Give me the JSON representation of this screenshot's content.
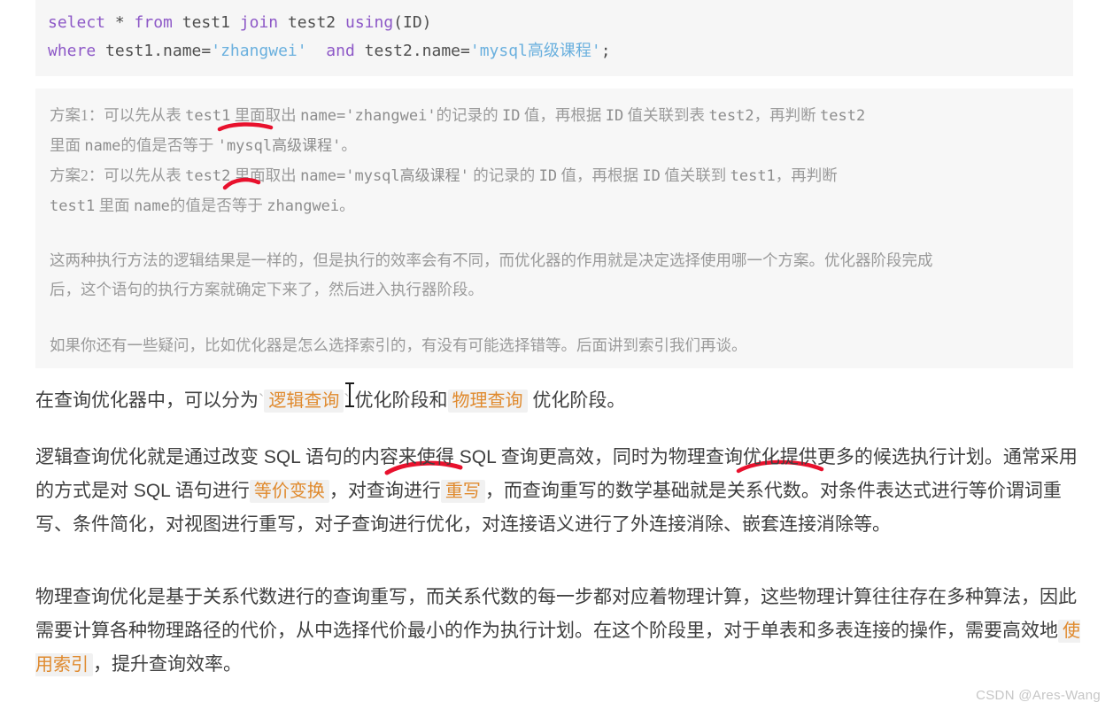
{
  "code_block": {
    "language": "sql",
    "line1": {
      "kw_select": "select",
      "star": " * ",
      "kw_from": "from",
      "t1": " test1 ",
      "kw_join": "join",
      "t2": " test2 ",
      "kw_using": "using",
      "using_args": "(ID)"
    },
    "line2": {
      "kw_where": "where",
      "col1": " test1.name=",
      "str1": "'zhangwei'",
      "kw_and": "  and ",
      "col2": "test2.name=",
      "str2": "'mysql高级课程'",
      "semi": ";"
    }
  },
  "quote": {
    "plan1_line1_a": "方案1：可以先从表 ",
    "plan1_line1_t": "test1",
    "plan1_line1_b": " 里面取出 ",
    "plan1_line1_c": "name='zhangwei'",
    "plan1_line1_d": "的记录的 ",
    "plan1_line1_e": "ID",
    "plan1_line1_f": " 值，再根据 ",
    "plan1_line1_g": "ID",
    "plan1_line1_h": " 值关联到表 ",
    "plan1_line1_i": "test2",
    "plan1_line1_j": "，再判断 ",
    "plan1_line1_k": "test2",
    "plan1_line2_a": "里面 ",
    "plan1_line2_b": "name",
    "plan1_line2_c": "的值是否等于 ",
    "plan1_line2_d": "'mysql高级课程'",
    "plan1_line2_e": "。",
    "plan2_line1_a": "方案2：可以先从表 ",
    "plan2_line1_t": "test2",
    "plan2_line1_b": " 里面取出 ",
    "plan2_line1_c": "name='mysql高级课程'",
    "plan2_line1_d": " 的记录的 ",
    "plan2_line1_e": "ID",
    "plan2_line1_f": " 值，再根据 ",
    "plan2_line1_g": "ID",
    "plan2_line1_h": " 值关联到 ",
    "plan2_line1_i": "test1",
    "plan2_line1_j": "，再判断",
    "plan2_line2_a": "test1",
    "plan2_line2_b": " 里面 ",
    "plan2_line2_c": "name",
    "plan2_line2_d": "的值是否等于 ",
    "plan2_line2_e": "zhangwei",
    "plan2_line2_f": "。",
    "explain_line1": "这两种执行方法的逻辑结果是一样的，但是执行的效率会有不同，而优化器的作用就是决定选择使用哪一个方案。优化器阶段完成",
    "explain_line2": "后，这个语句的执行方案就确定下来了，然后进入执行器阶段。",
    "note_line": "如果你还有一些疑问，比如优化器是怎么选择索引的，有没有可能选择错等。后面讲到索引我们再谈。"
  },
  "paragraphs": {
    "p1_a": "在查询优化器中，可以分为",
    "p1_tick1": "`",
    "p1_code1": "逻辑查询",
    "p1_tick2": "`",
    "p1_b": " 优化阶段和",
    "p1_code2": "物理查询",
    "p1_c": " 优化阶段。",
    "p2_a": "逻辑查询优化就是通过改变 SQL 语句的内容来使得 SQL 查询更高效，同时为物理查询优化提供更多的候选执行计划。通常采用的方式是对 SQL 语句进行",
    "p2_code1": "等价变换",
    "p2_b": "，对查询进行",
    "p2_code2": "重写",
    "p2_c": "，而查询重写的数学基础就是关系代数。对条件表达式进行等价谓词重写、条件简化，对视图进行重写，对子查询进行优化，对连接语义进行了外连接消除、嵌套连接消除等。",
    "p3_a": "物理查询优化是基于关系代数进行的查询重写，而关系代数的每一步都对应着物理计算，这些物理计算往往存在多种算法，因此需要计算各种物理路径的代价，从中选择代价最小的作为执行计划。在这个阶段里，对于单表和多表连接的操作，需要高效地",
    "p3_code1": "使用索引",
    "p3_b": "，提升查询效率。"
  },
  "annotations": {
    "pen_color": "#e8112d",
    "marks": [
      {
        "name": "underline-test1",
        "target": "test1"
      },
      {
        "name": "underline-test2",
        "target": "test2"
      },
      {
        "name": "underline-neirong-laishide",
        "target": "内容来使得"
      },
      {
        "name": "underline-wuli-chaxun",
        "target": "物理查询"
      }
    ]
  },
  "watermark": {
    "text": "CSDN @Ares-Wang"
  }
}
